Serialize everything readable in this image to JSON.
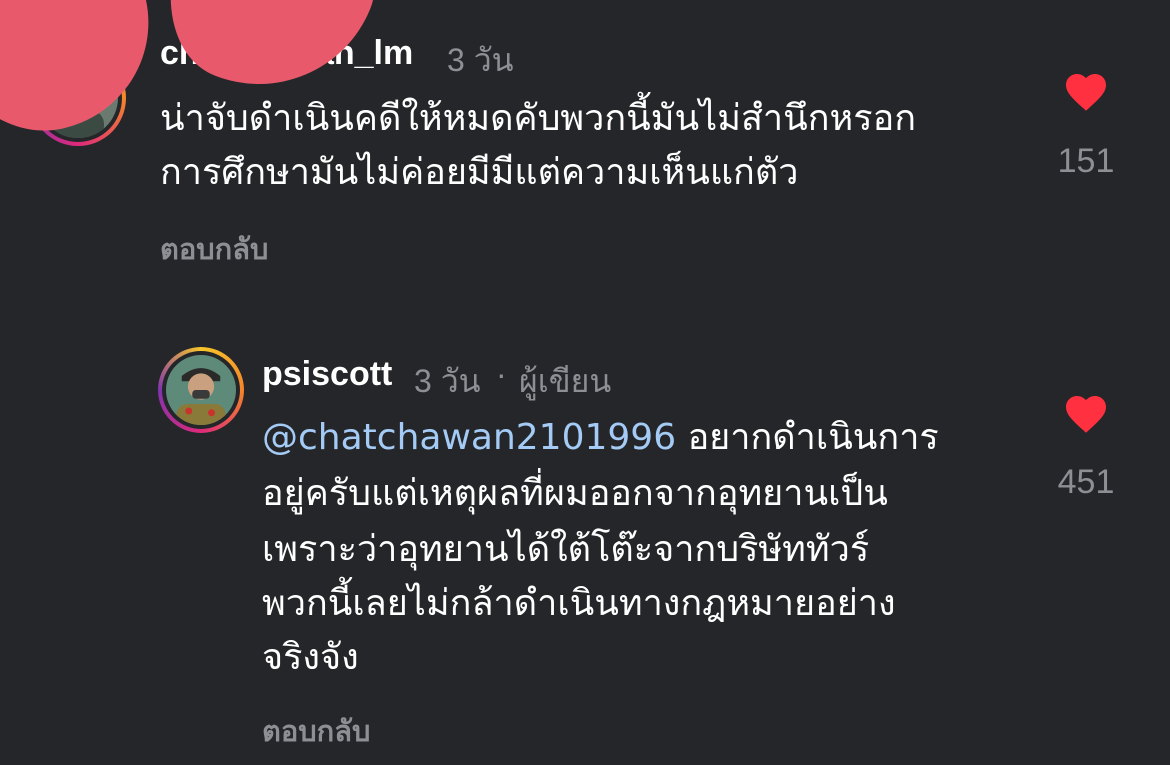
{
  "comments": [
    {
      "username": "chatchawan_lm",
      "time": "3 วัน",
      "lines": [
        "น่าจับดำเนินคดีให้หมดคับพวกนี้มันไม่สำนึกหรอก",
        "การศึกษามันไม่ค่อยมีมีแต่ความเห็นแก่ตัว"
      ],
      "reply_label": "ตอบกลับ",
      "likes": "151",
      "liked": true
    },
    {
      "username": "psiscott",
      "time": "3 วัน",
      "separator": "·",
      "author_badge": "ผู้เขียน",
      "mention": "@chatchawan2101996",
      "lines": [
        "อยากดำเนินการ",
        "อยู่ครับแต่เหตุผลที่ผมออกจากอุทยานเป็น",
        "เพราะว่าอุทยานได้ใต้โต๊ะจากบริษัททัวร์",
        "พวกนี้เลยไม่กล้าดำเนินทางกฎหมายอย่าง",
        "จริงจัง"
      ],
      "reply_label": "ตอบกลับ",
      "likes": "451",
      "liked": true
    }
  ],
  "colors": {
    "background": "#252629",
    "heart": "#ff3040",
    "muted_text": "#8e8f94",
    "mention": "#a4cbf5",
    "sticker": "#e85a6b"
  },
  "icons": {
    "like": "heart-filled-icon"
  }
}
